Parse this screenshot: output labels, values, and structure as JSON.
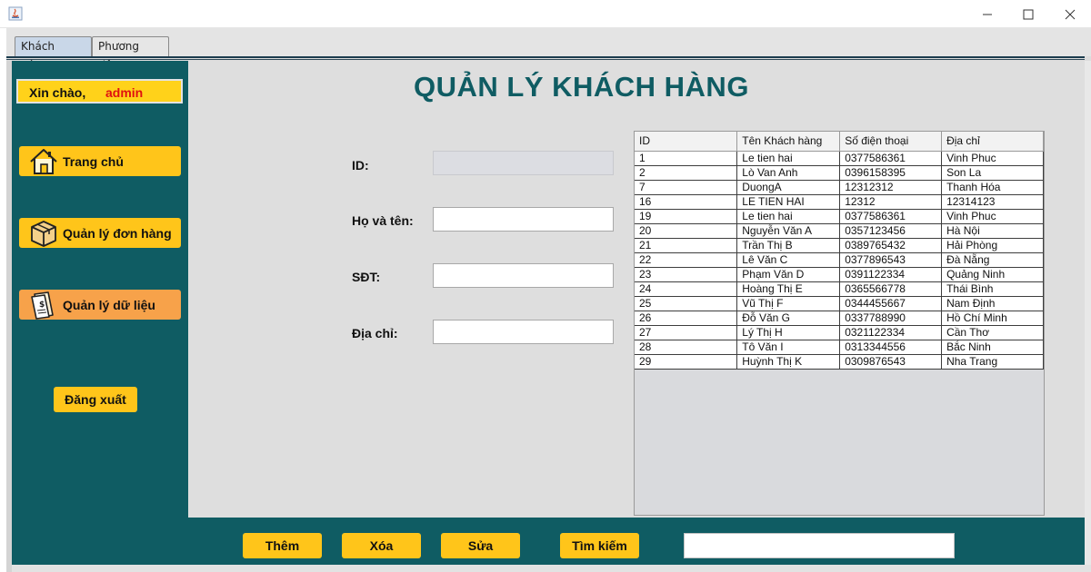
{
  "window": {
    "title": "",
    "minimize_glyph": "—",
    "maximize_glyph": "☐",
    "close_glyph": "✕"
  },
  "tabs": [
    {
      "label": "Khách Hàng",
      "active": true
    },
    {
      "label": "Phương tiện",
      "active": false
    }
  ],
  "sidebar": {
    "greeting_label": "Xin chào,",
    "username": "admin",
    "items": [
      {
        "label": "Trang chủ",
        "icon": "home-icon"
      },
      {
        "label": "Quản lý đơn hàng",
        "icon": "package-box-icon"
      },
      {
        "label": "Quản lý dữ liệu",
        "icon": "document-dollar-icon"
      }
    ],
    "logout_label": "Đăng xuất"
  },
  "page": {
    "title": "QUẢN LÝ KHÁCH HÀNG"
  },
  "form": {
    "id_label": "ID:",
    "id_value": "",
    "name_label": "Họ và tên:",
    "name_value": "",
    "phone_label": "SĐT:",
    "phone_value": "",
    "address_label": "Địa chỉ:",
    "address_value": ""
  },
  "table": {
    "columns": [
      "ID",
      "Tên Khách hàng",
      "Số điện thoại",
      "Địa chỉ"
    ],
    "rows": [
      [
        "1",
        "Le tien hai",
        "0377586361",
        "Vinh Phuc"
      ],
      [
        "2",
        "Lò Van Anh",
        "0396158395",
        "Son La"
      ],
      [
        "7",
        "DuongA",
        "12312312",
        "Thanh Hóa"
      ],
      [
        "16",
        "LE TIEN HAI",
        "12312",
        "12314123"
      ],
      [
        "19",
        "Le tien hai",
        "0377586361",
        "Vinh Phuc"
      ],
      [
        "20",
        "Nguyễn Văn A",
        "0357123456",
        "Hà Nội"
      ],
      [
        "21",
        "Trần Thị B",
        "0389765432",
        "Hải Phòng"
      ],
      [
        "22",
        "Lê Văn C",
        "0377896543",
        "Đà Nẵng"
      ],
      [
        "23",
        "Phạm Văn D",
        "0391122334",
        "Quảng Ninh"
      ],
      [
        "24",
        "Hoàng Thị E",
        "0365566778",
        "Thái Bình"
      ],
      [
        "25",
        "Vũ Thị F",
        "0344455667",
        "Nam Định"
      ],
      [
        "26",
        "Đỗ Văn G",
        "0337788990",
        "Hồ Chí Minh"
      ],
      [
        "27",
        "Lý Thị H",
        "0321122334",
        "Cần Thơ"
      ],
      [
        "28",
        "Tô Văn I",
        "0313344556",
        "Bắc Ninh"
      ],
      [
        "29",
        "Huỳnh Thị K",
        "0309876543",
        "Nha Trang"
      ]
    ]
  },
  "actions": {
    "add_label": "Thêm",
    "delete_label": "Xóa",
    "edit_label": "Sửa",
    "search_label": "Tìm kiếm",
    "search_value": ""
  },
  "colors": {
    "teal": "#0f5c63",
    "button_yellow": "#ffc51a",
    "button_orange": "#f7a24a",
    "username_red": "#e01010"
  }
}
